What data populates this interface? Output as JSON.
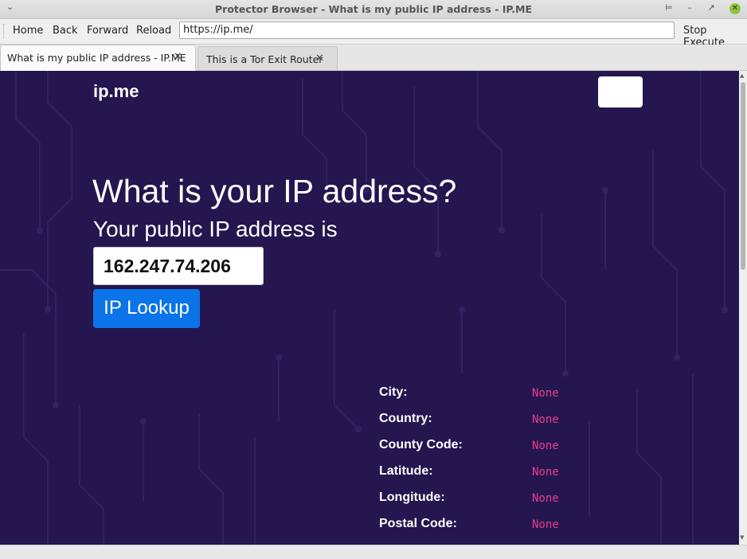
{
  "window": {
    "title": "Protector Browser - What is my public IP address - IP.ME"
  },
  "toolbar": {
    "home": "Home",
    "back": "Back",
    "forward": "Forward",
    "reload": "Reload",
    "url": "https://ip.me/",
    "stop_execute": "Stop Execute"
  },
  "tabs": [
    {
      "label": "What is my public IP address - IP.ME"
    },
    {
      "label": "This is a Tor Exit Router"
    }
  ],
  "page": {
    "brand": "ip.me",
    "heading": "What is your IP address?",
    "subheading": "Your public IP address is",
    "ip_value": "162.247.74.206",
    "lookup_button": "IP Lookup",
    "info": [
      {
        "label": "City:",
        "value": "None"
      },
      {
        "label": "Country:",
        "value": "None"
      },
      {
        "label": "County Code:",
        "value": "None"
      },
      {
        "label": "Latitude:",
        "value": "None"
      },
      {
        "label": "Longitude:",
        "value": "None"
      },
      {
        "label": "Postal Code:",
        "value": "None"
      }
    ],
    "colors": {
      "background": "#25164f",
      "accent_button": "#0a74e8",
      "value_text": "#e83e8c"
    }
  }
}
